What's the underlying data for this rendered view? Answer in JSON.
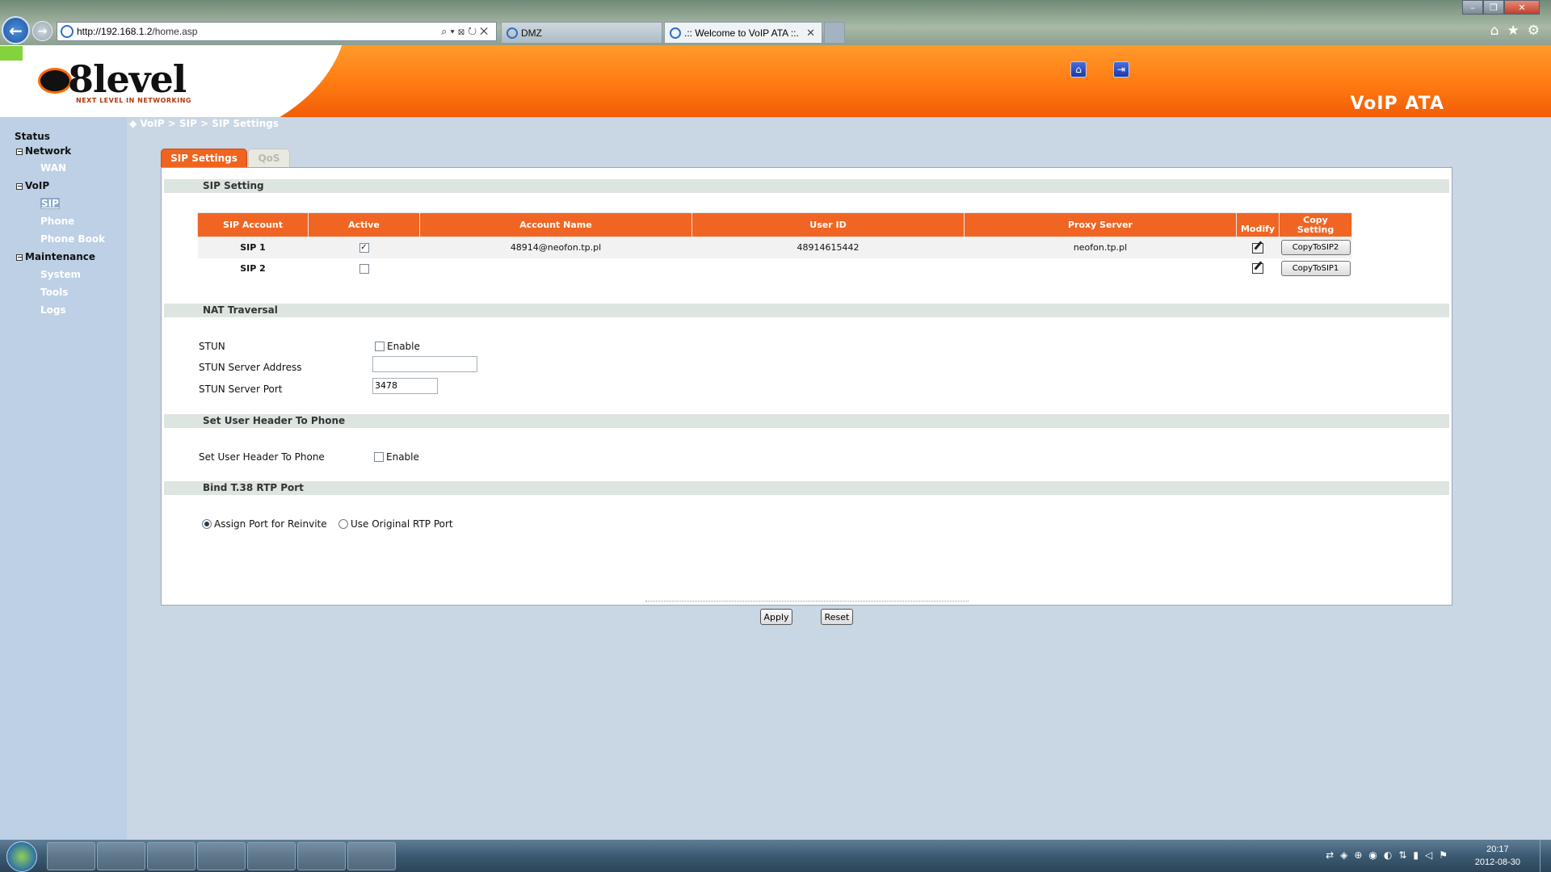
{
  "browser": {
    "address_host": "http://192.168.1.2",
    "address_path": "/home.asp",
    "address_tools": "⌕▾⊠↻✕",
    "tabs": [
      {
        "title": "DMZ"
      },
      {
        "title": ".:: Welcome to VoIP ATA ::."
      }
    ],
    "win_controls": {
      "minimize": "–",
      "maximize": "❐",
      "close": "✕"
    },
    "chrome_icons": {
      "home": "⌂",
      "favorites": "★",
      "tools": "⚙"
    }
  },
  "header": {
    "logo_text": "8level",
    "logo_tagline": "NEXT LEVEL IN NETWORKING",
    "product_name": "VoIP ATA",
    "home_icon": "house-icon",
    "logout_icon": "logout-icon"
  },
  "sidebar": {
    "status": "Status",
    "network": "Network",
    "wan": "WAN",
    "voip": "VoIP",
    "sip": "SIP",
    "phone": "Phone",
    "phone_book": "Phone Book",
    "maintenance": "Maintenance",
    "system": "System",
    "tools": "Tools",
    "logs": "Logs",
    "expander": "−"
  },
  "breadcrumb": "◆ VoIP > SIP > SIP Settings",
  "tabs": {
    "sip_settings": "SIP Settings",
    "qos": "QoS"
  },
  "sections": {
    "sip_setting": "SIP Setting",
    "nat_traversal": "NAT Traversal",
    "user_header": "Set User Header To Phone",
    "t38": "Bind T.38 RTP Port"
  },
  "sip_table": {
    "headers": {
      "account": "SIP Account",
      "active": "Active",
      "account_name": "Account Name",
      "user_id": "User ID",
      "proxy": "Proxy Server",
      "modify": "Modify",
      "copy": "Copy Setting"
    },
    "rows": [
      {
        "account": "SIP 1",
        "active": "✓",
        "account_name": "48914@neofon.tp.pl",
        "user_id": "48914615442",
        "proxy": "neofon.tp.pl",
        "copy_label": "CopyToSIP2"
      },
      {
        "account": "SIP 2",
        "active": "",
        "account_name": "",
        "user_id": "",
        "proxy": "",
        "copy_label": "CopyToSIP1"
      }
    ]
  },
  "nat": {
    "stun_label": "STUN",
    "stun_enable": "Enable",
    "stun_enabled": false,
    "server_address_label": "STUN Server Address",
    "server_address_value": "",
    "server_port_label": "STUN Server Port",
    "server_port_value": "3478"
  },
  "user_header": {
    "label": "Set User Header To Phone",
    "enable": "Enable",
    "enabled": false
  },
  "t38": {
    "options": [
      {
        "label": "Assign Port for Reinvite",
        "selected": true
      },
      {
        "label": "Use Original RTP Port",
        "selected": false
      }
    ]
  },
  "actions": {
    "apply": "Apply",
    "reset": "Reset"
  },
  "taskbar": {
    "clock_time": "20:17",
    "clock_date": "2012-08-30",
    "tray_icons": "⇄◈⊕◉◐⇅▮◁⚑"
  },
  "colors": {
    "accent_orange": "#f06523",
    "banner_orange": "#ff7a12",
    "sidebar_blue": "#bdd0e5",
    "page_bg": "#c9d6e4"
  }
}
